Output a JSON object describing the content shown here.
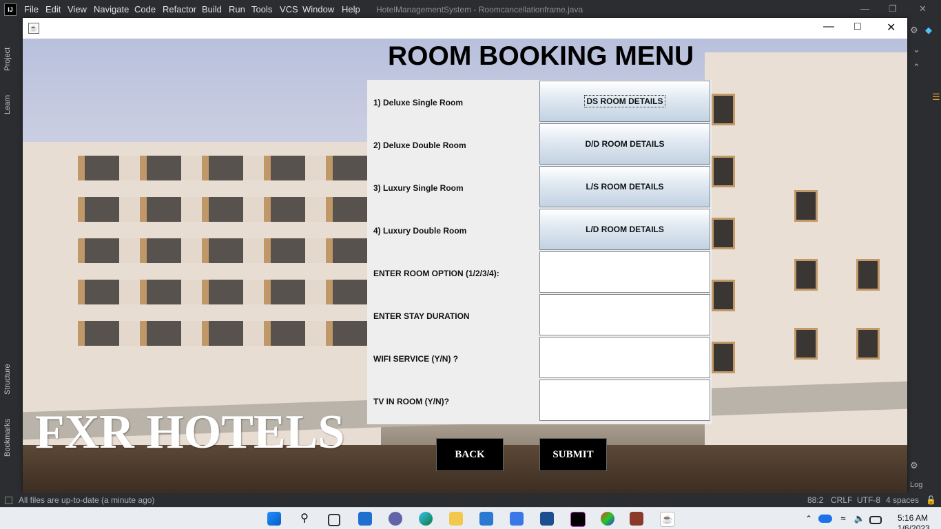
{
  "ide": {
    "logo": "IJ",
    "menu": [
      "File",
      "Edit",
      "View",
      "Navigate",
      "Code",
      "Refactor",
      "Build",
      "Run",
      "Tools",
      "VCS",
      "Window",
      "Help"
    ],
    "title": "HotelManagementSystem - Roomcancellationframe.java",
    "side_tabs": {
      "project": "Project",
      "learn": "Learn",
      "structure": "Structure",
      "bookmarks": "Bookmarks"
    },
    "status": {
      "message": "All files are up-to-date (a minute ago)",
      "position": "88:2",
      "line_sep": "CRLF",
      "encoding": "UTF-8",
      "indent": "4 spaces"
    },
    "right_label": "Log"
  },
  "frame": {
    "title": "ROOM BOOKING MENU",
    "brand": "FXR HOTELS",
    "rows": [
      {
        "label": "1) Deluxe Single Room",
        "button": "DS ROOM DETAILS"
      },
      {
        "label": "2) Deluxe Double Room",
        "button": "D/D ROOM DETAILS"
      },
      {
        "label": "3) Luxury Single Room",
        "button": "L/S ROOM DETAILS"
      },
      {
        "label": "4) Luxury Double Room",
        "button": "L/D ROOM DETAILS"
      }
    ],
    "fields": [
      {
        "label": "ENTER ROOM OPTION (1/2/3/4):",
        "value": ""
      },
      {
        "label": "ENTER STAY DURATION",
        "value": ""
      },
      {
        "label": "WIFI SERVICE (Y/N) ?",
        "value": ""
      },
      {
        "label": "TV IN ROOM (Y/N)?",
        "value": ""
      }
    ],
    "back": "BACK",
    "submit": "SUBMIT"
  },
  "taskbar": {
    "time": "5:16 AM",
    "date": "1/6/2023"
  },
  "colors": {
    "button_gradient_top": "#ffffff",
    "button_gradient_bottom": "#c3d2e1",
    "action_button_bg": "#000000"
  },
  "icons": [
    "windows-start-icon",
    "search-icon",
    "task-view-icon",
    "widgets-icon",
    "chat-icon",
    "edge-icon",
    "file-explorer-icon",
    "mail-icon",
    "store-icon",
    "intellij-icon",
    "java-icon",
    "onedrive-icon",
    "wifi-icon",
    "volume-icon",
    "battery-icon"
  ]
}
